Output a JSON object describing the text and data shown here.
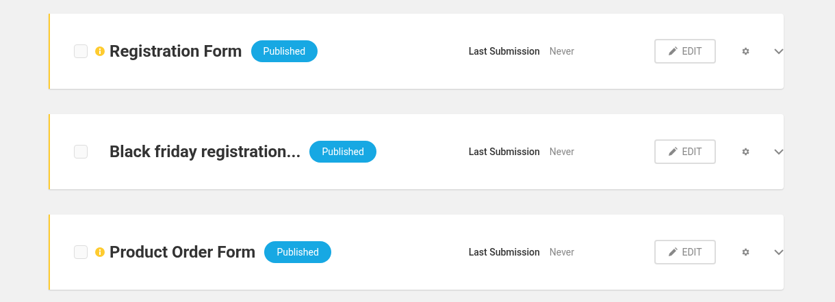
{
  "forms": [
    {
      "title": "Registration Form",
      "warning": true,
      "checked": false,
      "status": "Published",
      "last_submission_label": "Last Submission",
      "last_submission": "Never",
      "edit": "EDIT"
    },
    {
      "title": "Black friday registration...",
      "warning": false,
      "checked": false,
      "status": "Published",
      "last_submission_label": "Last Submission",
      "last_submission": "Never",
      "edit": "EDIT"
    },
    {
      "title": "Product Order Form",
      "warning": true,
      "checked": false,
      "status": "Published",
      "last_submission_label": "Last Submission",
      "last_submission": "Never",
      "edit": "EDIT"
    }
  ]
}
